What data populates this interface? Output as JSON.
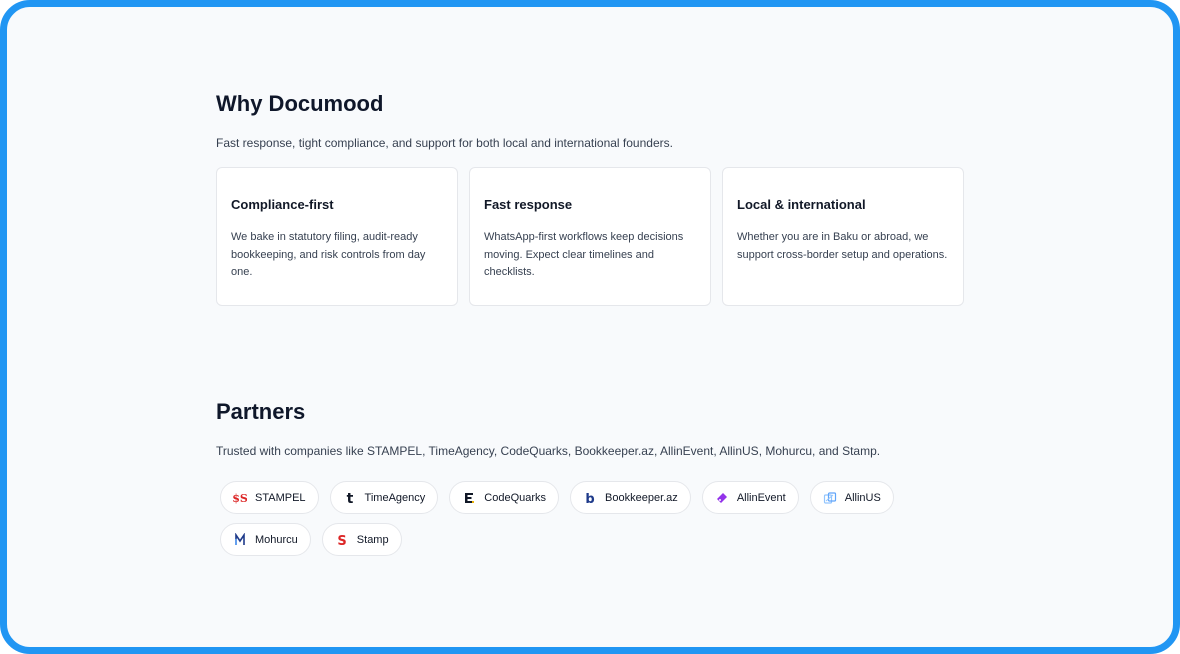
{
  "why": {
    "title": "Why Documood",
    "subtitle": "Fast response, tight compliance, and support for both local and international founders.",
    "cards": [
      {
        "title": "Compliance-first",
        "body": "We bake in statutory filing, audit-ready bookkeeping, and risk controls from day one."
      },
      {
        "title": "Fast response",
        "body": "WhatsApp-first workflows keep decisions moving. Expect clear timelines and checklists."
      },
      {
        "title": "Local & international",
        "body": "Whether you are in Baku or abroad, we support cross-border setup and operations."
      }
    ]
  },
  "partners": {
    "title": "Partners",
    "subtitle": "Trusted with companies like STAMPEL, TimeAgency, CodeQuarks, Bookkeeper.az, AllinEvent, AllinUS, Mohurcu, and Stamp.",
    "items": [
      {
        "label": "STAMPEL",
        "icon": "stampel-logo-icon",
        "color": "#dc2626"
      },
      {
        "label": "TimeAgency",
        "icon": "timeagency-logo-icon",
        "color": "#111827"
      },
      {
        "label": "CodeQuarks",
        "icon": "codequarks-logo-icon",
        "color": "#111827"
      },
      {
        "label": "Bookkeeper.az",
        "icon": "bookkeeper-logo-icon",
        "color": "#1e3a8a"
      },
      {
        "label": "AllinEvent",
        "icon": "allinevent-logo-icon",
        "color": "#9333ea"
      },
      {
        "label": "AllinUS",
        "icon": "allinus-logo-icon",
        "color": "#93c5fd"
      },
      {
        "label": "Mohurcu",
        "icon": "mohurcu-logo-icon",
        "color": "#1e3a8a"
      },
      {
        "label": "Stamp",
        "icon": "stamp-logo-icon",
        "color": "#dc2626"
      }
    ]
  }
}
